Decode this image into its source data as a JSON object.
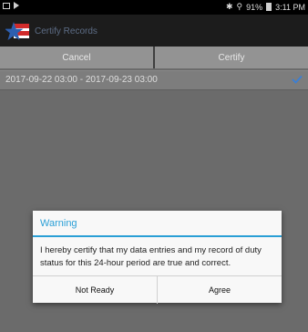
{
  "status_bar": {
    "battery": "91%",
    "time": "3:11 PM"
  },
  "app_bar": {
    "title": "Certify Records"
  },
  "actions": {
    "cancel_label": "Cancel",
    "certify_label": "Certify"
  },
  "records": [
    {
      "period": "2017-09-22 03:00 - 2017-09-23 03:00",
      "checked": true
    }
  ],
  "dialog": {
    "title": "Warning",
    "message": "I hereby certify that my data entries and my record of duty status for this 24-hour period are true and correct.",
    "not_ready_label": "Not Ready",
    "agree_label": "Agree"
  },
  "colors": {
    "accent": "#2a9fd6",
    "dim_background": "#6b6b6b"
  },
  "icons": [
    "app-logo-star-flag-icon",
    "checkmark-icon",
    "bluetooth-icon",
    "wifi-icon",
    "battery-icon"
  ]
}
